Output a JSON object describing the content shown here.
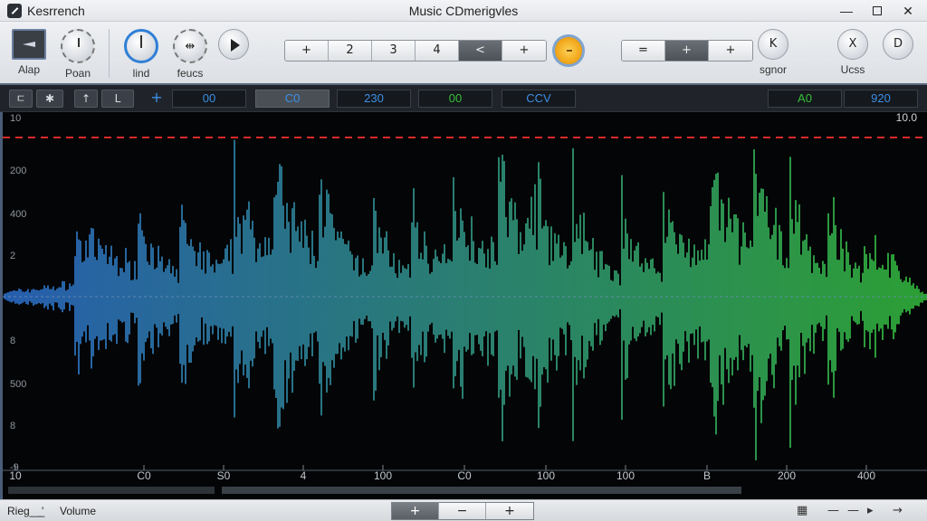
{
  "window": {
    "app_name": "Kesrrench",
    "title": "Music CDmerigvles",
    "minimize": "—",
    "close": "✕"
  },
  "toolbar": {
    "tools": [
      {
        "label": "Alap"
      },
      {
        "label": "Poan"
      },
      {
        "label": "lind"
      },
      {
        "label": "feucs"
      }
    ],
    "steps": [
      "+",
      "2",
      "3",
      "4",
      "<",
      "+"
    ],
    "steps_active_index": 4,
    "right_seg": [
      "=",
      "+",
      "+"
    ],
    "right_knobs": [
      {
        "glyph": "K",
        "label": "sgnor"
      },
      {
        "glyph": "X",
        "label": "Ucss"
      },
      {
        "glyph": "D",
        "label": ""
      }
    ]
  },
  "subbar": {
    "left_buttons": [
      "ㄷ",
      "✱",
      "↑",
      "L"
    ],
    "add": "+",
    "fields": [
      {
        "value": "00",
        "color": "blue"
      },
      {
        "value": "C0",
        "color": "blue",
        "active": true
      },
      {
        "value": "230",
        "color": "blue"
      },
      {
        "value": "00",
        "color": "green"
      },
      {
        "value": "CCV",
        "color": "blue"
      },
      {
        "value": "A0",
        "color": "green"
      },
      {
        "value": "920",
        "color": "blue"
      }
    ]
  },
  "waveform": {
    "y_labels": [
      "10",
      "200",
      "400",
      "2",
      "8",
      "500",
      "8",
      "-9"
    ],
    "top_right_label": "10.0",
    "x_labels": [
      "10",
      "C0",
      "S0",
      "4",
      "100",
      "C0",
      "100",
      "100",
      "B",
      "200",
      "400"
    ],
    "gradient_start": "#2f74d8",
    "gradient_end": "#37c640",
    "clip_line_color": "#d92a2a"
  },
  "statusbar": {
    "left_label": "Rieg_ ̲ ̲'",
    "volume_label": "Volume",
    "seg": [
      "+",
      "−",
      "+"
    ],
    "right_icons": [
      "▦",
      "—",
      "—",
      "▸",
      "→"
    ]
  }
}
